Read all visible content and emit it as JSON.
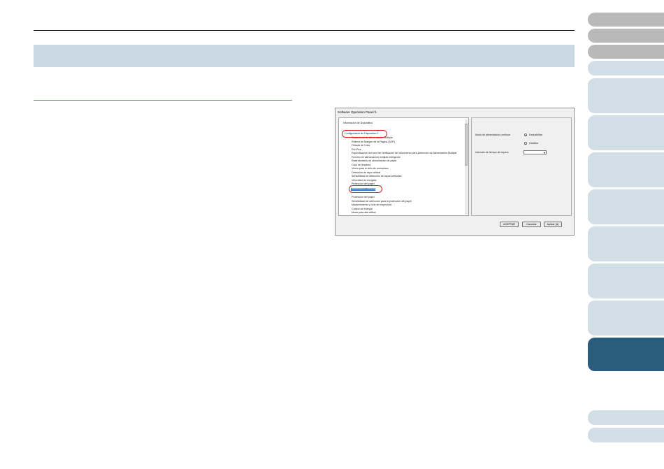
{
  "dialog": {
    "title": "Software Operation Panel fi-",
    "tree_items": [
      "Información de Dispositivo",
      "Configuración de Dispositivo 2",
      "Tratamiento de Alimentación Múltiple",
      "Relleno de Margen de la Página (ADF)",
      "Filtrado de Color",
      "Pre-Pick",
      "Especificación del área de verificación del documento para Detección de Alimentación Múltiple",
      "Función de alimentación múltiple inteligente",
      "Rastreamiento de alimentación de papel",
      "Ciclo de limpieza",
      "Visión para el ciclo de reemplazo",
      "Detección de rayo vertical",
      "Sensibilidad de detección de rayos verticales",
      "Velocidad de recogida",
      "Protección del papel",
      "Alimentación manual",
      "Protección del papel",
      "Sensibilidad de detección para la protección del papel",
      "Mantenimiento y ciclo de inspección",
      "Control de energía",
      "Modo para alta altitud"
    ],
    "settings": {
      "continuous_feed_label": "Modo de alimentación continua",
      "option_disable": "Deshabilitar",
      "option_enable": "Habilitar",
      "wait_time_label": "Intervalo de tiempo de espera",
      "wait_time_value": ""
    },
    "buttons": {
      "ok": "ACEPTAR",
      "cancel": "Cancelar",
      "apply": "Aplicar (A)"
    }
  }
}
